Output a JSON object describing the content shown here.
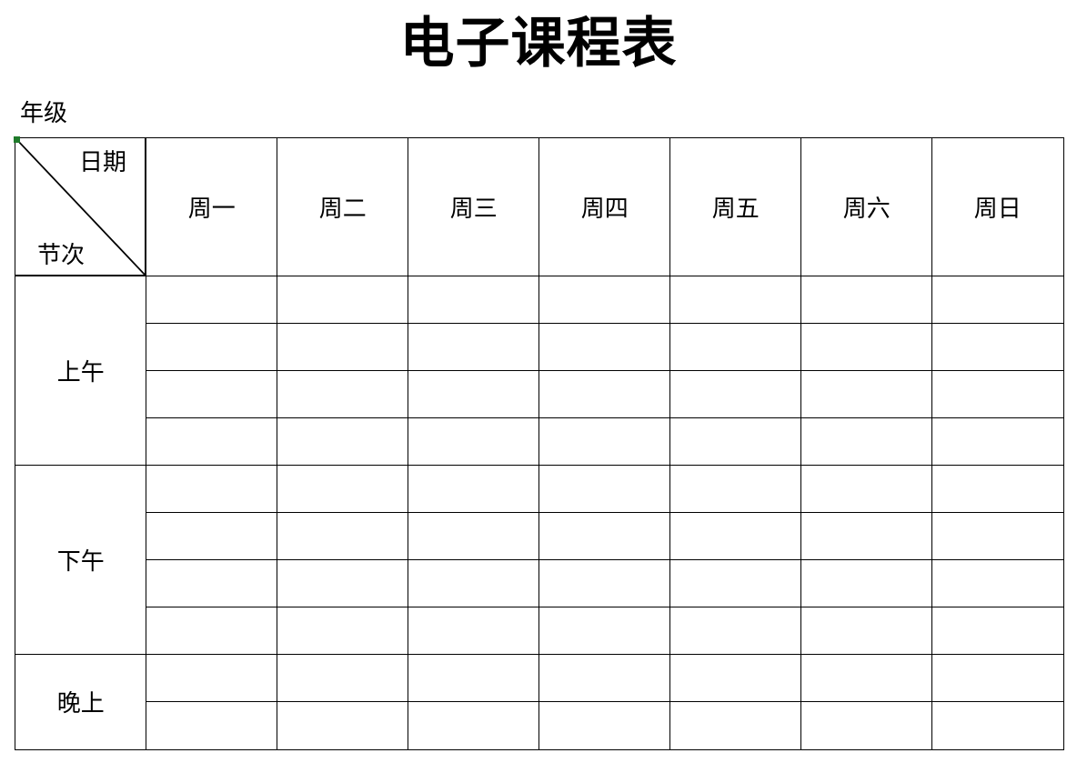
{
  "title": "电子课程表",
  "grade_label": "年级",
  "corner": {
    "top_right": "日期",
    "bottom_left": "节次"
  },
  "days": [
    "周一",
    "周二",
    "周三",
    "周四",
    "周五",
    "周六",
    "周日"
  ],
  "periods": [
    {
      "label": "上午",
      "rows": 4
    },
    {
      "label": "下午",
      "rows": 4
    },
    {
      "label": "晚上",
      "rows": 2
    }
  ],
  "cells": [
    [
      "",
      "",
      "",
      "",
      "",
      "",
      ""
    ],
    [
      "",
      "",
      "",
      "",
      "",
      "",
      ""
    ],
    [
      "",
      "",
      "",
      "",
      "",
      "",
      ""
    ],
    [
      "",
      "",
      "",
      "",
      "",
      "",
      ""
    ],
    [
      "",
      "",
      "",
      "",
      "",
      "",
      ""
    ],
    [
      "",
      "",
      "",
      "",
      "",
      "",
      ""
    ],
    [
      "",
      "",
      "",
      "",
      "",
      "",
      ""
    ],
    [
      "",
      "",
      "",
      "",
      "",
      "",
      ""
    ],
    [
      "",
      "",
      "",
      "",
      "",
      "",
      ""
    ],
    [
      "",
      "",
      "",
      "",
      "",
      "",
      ""
    ]
  ],
  "colors": {
    "line": "#000000",
    "selection_marker": "#1f7a2a"
  }
}
